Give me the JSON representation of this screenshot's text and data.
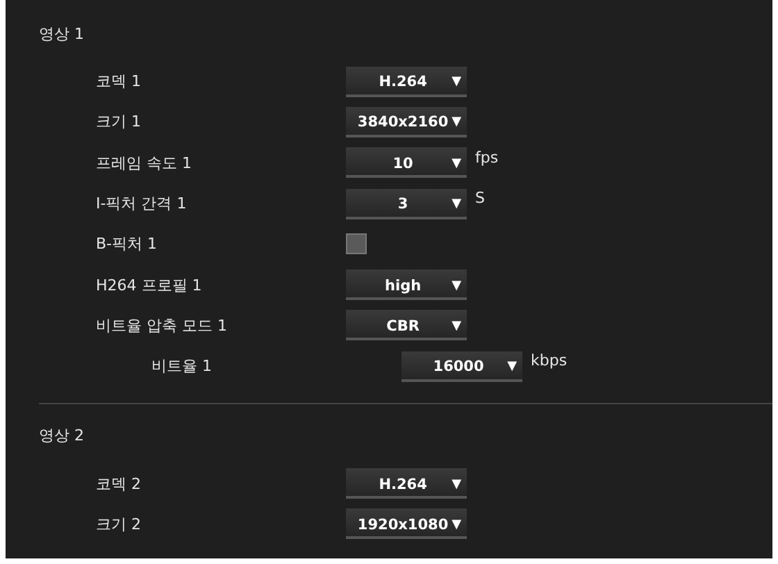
{
  "sections": [
    {
      "title": "영상 1",
      "rows": [
        {
          "kind": "select",
          "label": "코덱 1",
          "value": "H.264",
          "arrow": "▼"
        },
        {
          "kind": "select",
          "label": "크기 1",
          "value": "3840x2160",
          "arrow": "▼"
        },
        {
          "kind": "select",
          "label": "프레임 속도 1",
          "value": "10",
          "arrow": "▼",
          "unit": "fps"
        },
        {
          "kind": "select",
          "label": "I-픽처 간격 1",
          "value": "3",
          "arrow": "▼",
          "unit": "S"
        },
        {
          "kind": "checkbox",
          "label": "B-픽처 1",
          "checked": false
        },
        {
          "kind": "select",
          "label": "H264 프로필 1",
          "value": "high",
          "arrow": "▼"
        },
        {
          "kind": "select",
          "label": "비트율 압축 모드 1",
          "value": "CBR",
          "arrow": "▼",
          "children": [
            {
              "kind": "select",
              "label": "비트율 1",
              "value": "16000",
              "arrow": "▼",
              "unit": "kbps"
            }
          ]
        }
      ]
    },
    {
      "title": "영상 2",
      "rows": [
        {
          "kind": "select",
          "label": "코덱 2",
          "value": "H.264",
          "arrow": "▼"
        },
        {
          "kind": "select",
          "label": "크기 2",
          "value": "1920x1080",
          "arrow": "▼"
        }
      ]
    }
  ]
}
